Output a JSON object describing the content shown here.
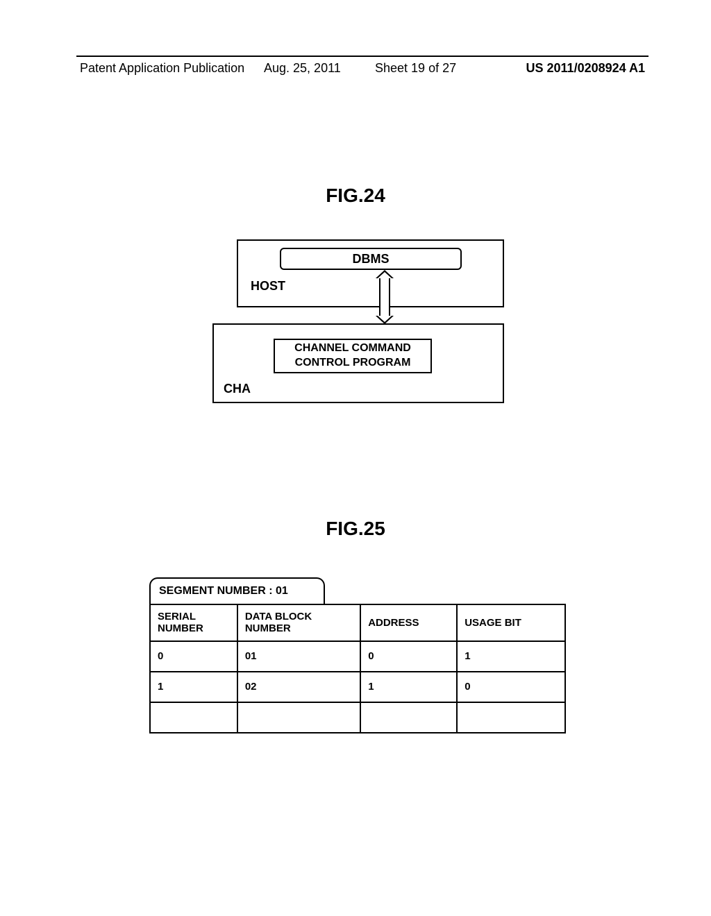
{
  "header": {
    "publication_label": "Patent Application Publication",
    "date": "Aug. 25, 2011",
    "sheet_info": "Sheet 19 of 27",
    "publication_number": "US 2011/0208924 A1"
  },
  "fig24": {
    "title": "FIG.24",
    "dbms_label": "DBMS",
    "host_label": "HOST",
    "program_line1": "CHANNEL COMMAND",
    "program_line2": "CONTROL PROGRAM",
    "cha_label": "CHA"
  },
  "fig25": {
    "title": "FIG.25",
    "segment_label": "SEGMENT NUMBER : 01",
    "headers": {
      "serial": "SERIAL NUMBER",
      "block": "DATA BLOCK NUMBER",
      "address": "ADDRESS",
      "usage": "USAGE BIT"
    },
    "rows": [
      {
        "serial": "0",
        "block": "01",
        "address": "0",
        "usage": "1"
      },
      {
        "serial": "1",
        "block": "02",
        "address": "1",
        "usage": "0"
      },
      {
        "serial": "",
        "block": "",
        "address": "",
        "usage": ""
      }
    ]
  }
}
